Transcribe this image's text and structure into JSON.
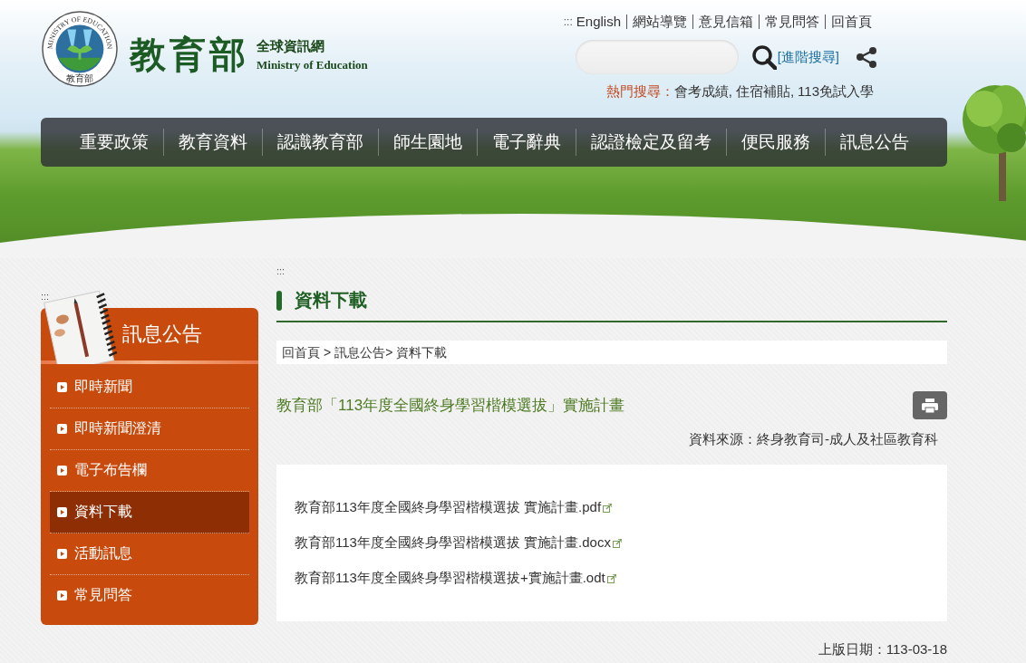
{
  "header": {
    "seal": {
      "ring_text": "MINISTRY OF EDUCATION",
      "name": "教育部"
    },
    "brand": {
      "name": "教育部",
      "subtitle": "全球資訊網",
      "english": "Ministry of Education"
    },
    "top_links": {
      "marker": ":::",
      "items": [
        "English",
        "網站導覽",
        "意見信箱",
        "常見問答",
        "回首頁"
      ]
    },
    "search": {
      "advanced_link": "[進階搜尋]"
    },
    "hot_search": {
      "label": "熱門搜尋：",
      "terms": [
        "會考成績,",
        "住宿補貼,",
        "113免試入學"
      ]
    }
  },
  "nav": {
    "items": [
      "重要政策",
      "教育資料",
      "認識教育部",
      "師生園地",
      "電子辭典",
      "認證檢定及留考",
      "便民服務",
      "訊息公告"
    ]
  },
  "sidebar": {
    "marker": ":::",
    "title": "訊息公告",
    "items": [
      {
        "label": "即時新聞",
        "selected": false
      },
      {
        "label": "即時新聞澄清",
        "selected": false
      },
      {
        "label": "電子布告欄",
        "selected": false
      },
      {
        "label": "資料下載",
        "selected": true
      },
      {
        "label": "活動訊息",
        "selected": false
      },
      {
        "label": "常見問答",
        "selected": false
      }
    ]
  },
  "content": {
    "marker": ":::",
    "heading": "資料下載",
    "breadcrumb": [
      "回首頁",
      "訊息公告",
      "資料下載"
    ],
    "breadcrumb_separator": ">",
    "article": {
      "title": "教育部「113年度全國終身學習楷模選拔」實施計畫",
      "source": "資料來源：終身教育司-成人及社區教育科",
      "files": [
        "教育部113年度全國終身學習楷模選拔 實施計畫.pdf",
        "教育部113年度全國終身學習楷模選拔 實施計畫.docx",
        "教育部113年度全國終身學習楷模選拔+實施計畫.odt"
      ],
      "updated": "上版日期：113-03-18"
    }
  }
}
